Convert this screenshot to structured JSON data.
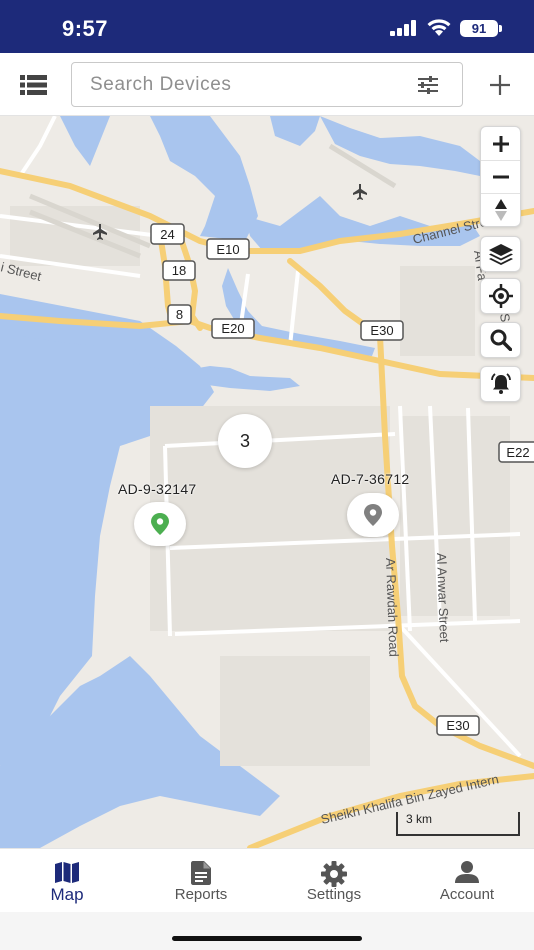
{
  "status_bar": {
    "time": "9:57",
    "battery": "91"
  },
  "top_bar": {
    "search_placeholder": "Search Devices",
    "list_icon": "list-icon",
    "filter_icon": "sliders-icon",
    "add_icon": "plus-icon"
  },
  "map": {
    "road_labels": [
      "24",
      "18",
      "8",
      "E10",
      "E20",
      "E30",
      "E30",
      "E22"
    ],
    "street_names": [
      "Channel Street",
      "Ar Rawdah Road",
      "Al Anwar Street",
      "Sheikh Khalifa Bin Zayed Intern",
      "i Street",
      "Al Fa",
      "St"
    ],
    "cluster_count": "3",
    "devices": [
      {
        "name": "AD-9-32147",
        "status_color": "#4caf50"
      },
      {
        "name": "AD-7-36712",
        "status_color": "#808080"
      }
    ],
    "scale": "3 km",
    "controls": {
      "zoom_in": "plus-icon",
      "zoom_out": "minus-icon",
      "compass": "compass-icon",
      "layers": "layers-icon",
      "locate": "crosshair-icon",
      "search": "search-icon",
      "alerts": "bell-icon"
    }
  },
  "nav": {
    "items": [
      {
        "label": "Map",
        "icon": "map-icon",
        "active": true
      },
      {
        "label": "Reports",
        "icon": "document-icon",
        "active": false
      },
      {
        "label": "Settings",
        "icon": "gear-icon",
        "active": false
      },
      {
        "label": "Account",
        "icon": "person-icon",
        "active": false
      }
    ]
  },
  "colors": {
    "brand": "#1d2a7a",
    "water": "#a9c5ee",
    "highway": "#f6cf76",
    "land": "#eeebe6"
  }
}
